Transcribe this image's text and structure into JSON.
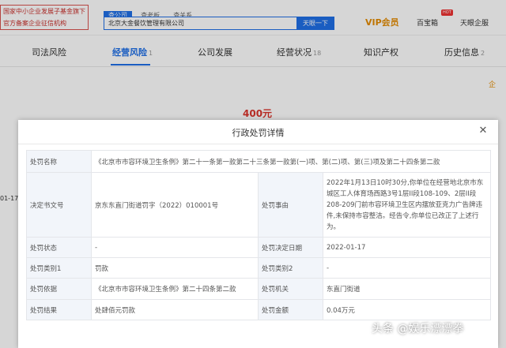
{
  "brand": {
    "line1": "国家中小企业发展子基金旗下",
    "line2": "官方备案企业征信机构"
  },
  "search": {
    "tabs": [
      "查公司",
      "查老板",
      "查关系"
    ],
    "query": "北京大金餐饮管理有限公司",
    "button": "天眼一下"
  },
  "header_right": {
    "vip": "VIP会员",
    "baibao": "百宝箱",
    "hot": "HOT",
    "tianyan": "天眼企服"
  },
  "nav": [
    {
      "label": "司法风险",
      "count": ""
    },
    {
      "label": "经营风险",
      "count": "1"
    },
    {
      "label": "公司发展",
      "count": ""
    },
    {
      "label": "经营状况",
      "count": "18"
    },
    {
      "label": "知识产权",
      "count": ""
    },
    {
      "label": "历史信息",
      "count": "2"
    }
  ],
  "background": {
    "amount": "400元",
    "date": "01-17",
    "side_chip": "企"
  },
  "modal": {
    "title": "行政处罚详情",
    "rows": {
      "r1": {
        "label": "处罚名称",
        "value": "《北京市市容环境卫生条例》第二十一条第一款第二十三条第一款第(一)项、第(二)项、第(三)项及第二十四条第二款"
      },
      "r2": {
        "l1": "决定书文号",
        "v1": "京东东直门街道罚字（2022）010001号",
        "l2": "处罚事由",
        "v2": "2022年1月13日10时30分,你单位在经营地北京市东城区工人体育场西路3号1层II段108-109、2层II段208-209门前市容环境卫生区内摆放亚克力广告牌违件,未保持市容整洁。经告令,你单位已改正了上述行为。"
      },
      "r3": {
        "l1": "处罚状态",
        "v1": "-",
        "l2": "处罚决定日期",
        "v2": "2022-01-17"
      },
      "r4": {
        "l1": "处罚类别1",
        "v1": "罚款",
        "l2": "处罚类别2",
        "v2": "-"
      },
      "r5": {
        "l1": "处罚依据",
        "v1": "《北京市市容环境卫生条例》第二十四条第二款",
        "l2": "处罚机关",
        "v2": "东直门街道"
      },
      "r6": {
        "l1": "处罚结果",
        "v1": "处肆佰元罚款",
        "l2": "处罚金额",
        "v2": "0.04万元"
      }
    }
  },
  "watermark": "头条 @娱乐漂漂拳"
}
